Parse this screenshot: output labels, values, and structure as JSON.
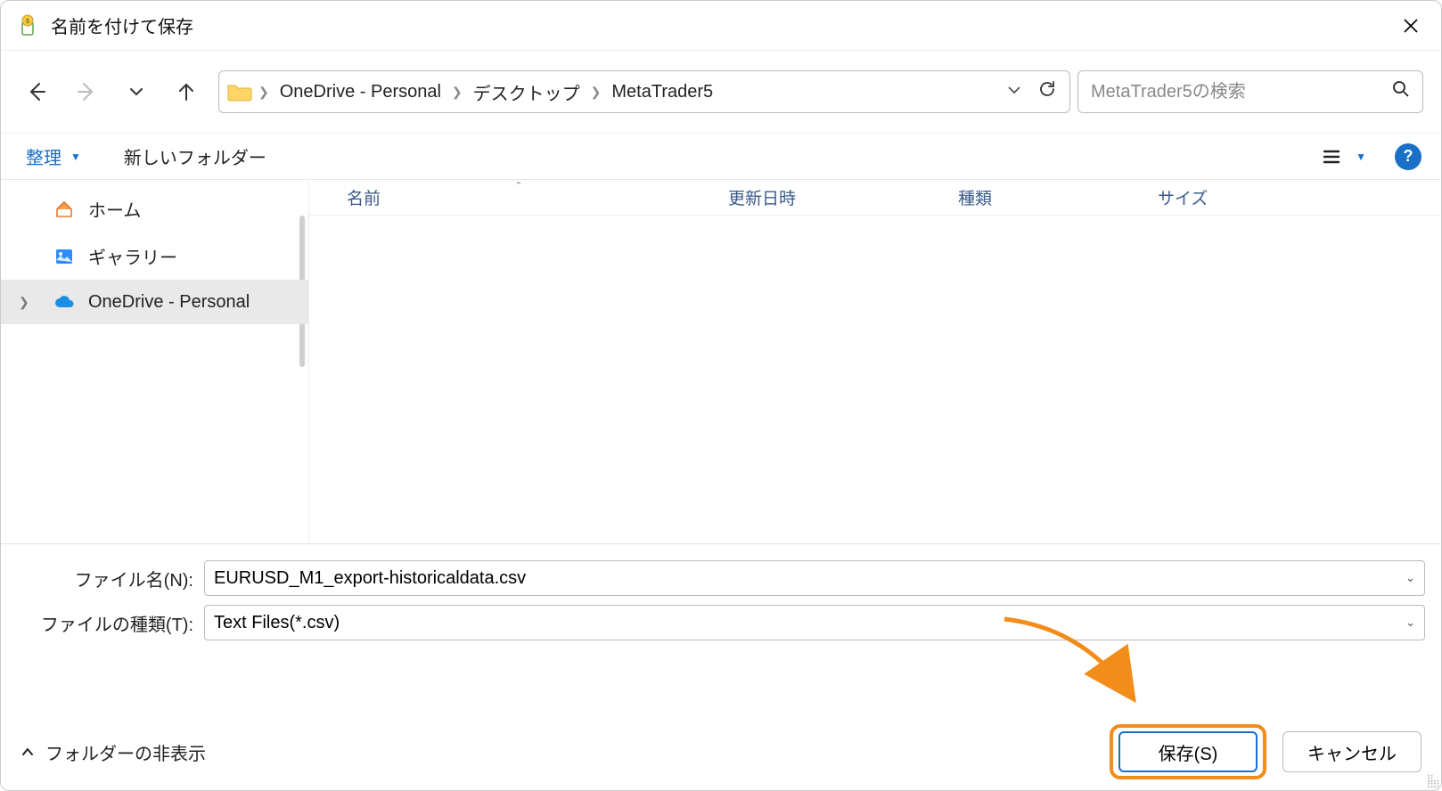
{
  "titlebar": {
    "title": "名前を付けて保存"
  },
  "nav": {
    "breadcrumb": [
      "OneDrive - Personal",
      "デスクトップ",
      "MetaTrader5"
    ]
  },
  "search": {
    "placeholder": "MetaTrader5の検索"
  },
  "toolbar": {
    "organize": "整理",
    "new_folder": "新しいフォルダー"
  },
  "sidebar": {
    "items": [
      {
        "label": "ホーム",
        "icon": "home"
      },
      {
        "label": "ギャラリー",
        "icon": "gallery"
      },
      {
        "label": "OneDrive - Personal",
        "icon": "cloud",
        "selected": true,
        "expandable": true
      }
    ]
  },
  "columns": {
    "name": "名前",
    "date": "更新日時",
    "type": "種類",
    "size": "サイズ"
  },
  "fields": {
    "filename_label": "ファイル名(N):",
    "filename_value": "EURUSD_M1_export-historicaldata.csv",
    "filetype_label": "ファイルの種類(T):",
    "filetype_value": "Text Files(*.csv)"
  },
  "footer": {
    "hide_folders": "フォルダーの非表示",
    "save": "保存(S)",
    "cancel": "キャンセル"
  }
}
